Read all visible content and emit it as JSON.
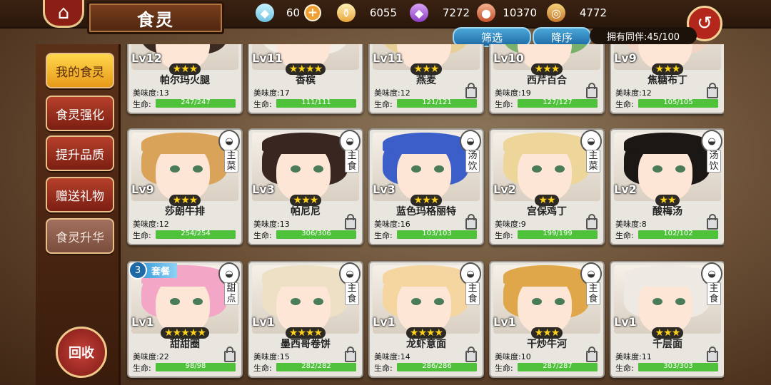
{
  "header": {
    "title": "食灵",
    "resources": [
      {
        "icon": "crystal-icon",
        "value": "60",
        "has_plus": true
      },
      {
        "icon": "potion-icon",
        "value": "6055",
        "has_plus": false
      },
      {
        "icon": "purple-gem-icon",
        "value": "7272",
        "has_plus": false
      },
      {
        "icon": "meat-icon",
        "value": "10370",
        "has_plus": false
      },
      {
        "icon": "drum-icon",
        "value": "4772",
        "has_plus": false
      }
    ]
  },
  "toolbar": {
    "filter_label": "筛选",
    "sort_label": "降序",
    "owned_label": "拥有同伴:45/100"
  },
  "sidebar": {
    "items": [
      {
        "label": "我的食灵",
        "state": "active"
      },
      {
        "label": "食灵强化",
        "state": "normal"
      },
      {
        "label": "提升品质",
        "state": "normal"
      },
      {
        "label": "赠送礼物",
        "state": "normal"
      },
      {
        "label": "食灵升华",
        "state": "dim"
      }
    ],
    "recycle_label": "回收"
  },
  "stat_labels": {
    "flavor": "美味度:",
    "hp": "生命:"
  },
  "set_meal": {
    "count": "3",
    "label": "套餐"
  },
  "cards": [
    {
      "level": "Lv12",
      "stars": "★★★",
      "name": "帕尔玛火腿",
      "flavor": "13",
      "hp": "247/247",
      "hp_frac": 1.0,
      "type": "",
      "hair": "#3a2a22",
      "locked": false
    },
    {
      "level": "Lv11",
      "stars": "★★★★",
      "name": "香槟",
      "flavor": "17",
      "hp": "111/111",
      "hp_frac": 1.0,
      "type": "",
      "hair": "#f1eee6",
      "locked": false
    },
    {
      "level": "Lv11",
      "stars": "★★★",
      "name": "燕麦",
      "flavor": "12",
      "hp": "121/121",
      "hp_frac": 1.0,
      "type": "",
      "hair": "#e8cf98",
      "locked": true
    },
    {
      "level": "Lv10",
      "stars": "★★★",
      "name": "西芹百合",
      "flavor": "19",
      "hp": "127/127",
      "hp_frac": 1.0,
      "type": "",
      "hair": "#79b06a",
      "locked": true
    },
    {
      "level": "Lv9",
      "stars": "★★★",
      "name": "焦糖布丁",
      "flavor": "12",
      "hp": "105/105",
      "hp_frac": 1.0,
      "type": "",
      "hair": "#f2d5c4",
      "locked": true
    },
    {
      "level": "Lv9",
      "stars": "★★★",
      "name": "莎朗牛排",
      "flavor": "12",
      "hp": "254/254",
      "hp_frac": 1.0,
      "type": "主菜",
      "hair": "#d9a45a",
      "locked": false
    },
    {
      "level": "Lv3",
      "stars": "★★★",
      "name": "帕尼尼",
      "flavor": "13",
      "hp": "306/306",
      "hp_frac": 1.0,
      "type": "主食",
      "hair": "#3a2620",
      "locked": true
    },
    {
      "level": "Lv3",
      "stars": "★★★",
      "name": "蓝色玛格丽特",
      "flavor": "16",
      "hp": "103/103",
      "hp_frac": 1.0,
      "type": "汤饮",
      "hair": "#3b5ec8",
      "locked": true
    },
    {
      "level": "Lv2",
      "stars": "★★",
      "name": "宫保鸡丁",
      "flavor": "9",
      "hp": "199/199",
      "hp_frac": 1.0,
      "type": "主菜",
      "hair": "#eed69a",
      "locked": true
    },
    {
      "level": "Lv2",
      "stars": "★★",
      "name": "酸梅汤",
      "flavor": "8",
      "hp": "102/102",
      "hp_frac": 1.0,
      "type": "汤饮",
      "hair": "#1b1714",
      "locked": true
    },
    {
      "level": "Lv1",
      "stars": "★★★★★",
      "name": "甜甜圈",
      "flavor": "22",
      "hp": "98/98",
      "hp_frac": 1.0,
      "type": "甜点",
      "hair": "#f3a6c6",
      "locked": true,
      "set_meal": true
    },
    {
      "level": "Lv1",
      "stars": "★★★★",
      "name": "墨西哥卷饼",
      "flavor": "15",
      "hp": "282/282",
      "hp_frac": 1.0,
      "type": "主食",
      "hair": "#ede0c4",
      "locked": true
    },
    {
      "level": "Lv1",
      "stars": "★★★★",
      "name": "龙虾意面",
      "flavor": "14",
      "hp": "286/286",
      "hp_frac": 1.0,
      "type": "主食",
      "hair": "#f5d5a0",
      "locked": true
    },
    {
      "level": "Lv1",
      "stars": "★★★",
      "name": "干炒牛河",
      "flavor": "10",
      "hp": "287/287",
      "hp_frac": 1.0,
      "type": "主食",
      "hair": "#e0a64a",
      "locked": true
    },
    {
      "level": "Lv1",
      "stars": "★★★",
      "name": "千层面",
      "flavor": "11",
      "hp": "303/303",
      "hp_frac": 1.0,
      "type": "主食",
      "hair": "#efe9e4",
      "locked": true
    }
  ]
}
